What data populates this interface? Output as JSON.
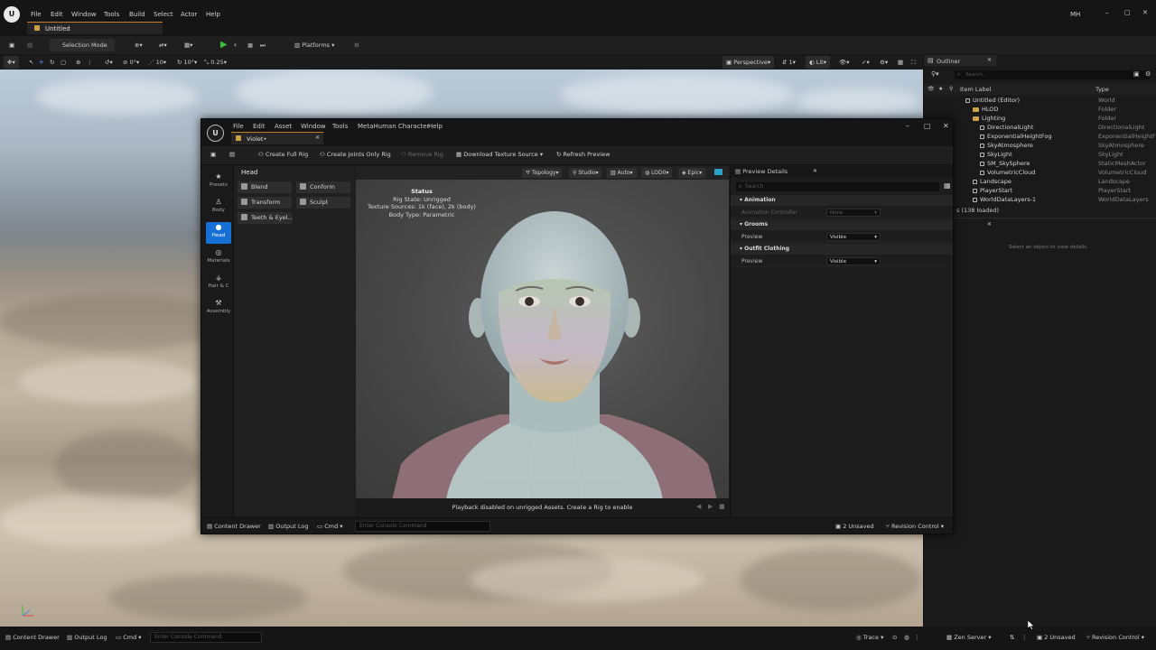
{
  "window": {
    "title": "Untitled",
    "user": "MH"
  },
  "main_menu": [
    "File",
    "Edit",
    "Window",
    "Tools",
    "Build",
    "Select",
    "Actor",
    "Help"
  ],
  "main_toolbar": {
    "selection_mode": "Selection Mode",
    "platforms": "Platforms"
  },
  "viewport_toolbar": {
    "angle_snap": "0°",
    "grid_snap": "10",
    "rotation_snap": "10°",
    "scale_snap": "0.25",
    "view_mode": "Perspective",
    "lighting": "Lit",
    "camera_speed": "1"
  },
  "outliner": {
    "tab": "Outliner",
    "search_placeholder": "Search...",
    "col_label": "Item Label",
    "col_type": "Type",
    "items": [
      {
        "label": "Untitled (Editor)",
        "type": "World"
      },
      {
        "label": "HLOD",
        "type": "Folder"
      },
      {
        "label": "Lighting",
        "type": "Folder"
      },
      {
        "label": "DirectionalLight",
        "type": "DirectionalLight"
      },
      {
        "label": "ExponentialHeightFog",
        "type": "ExponentialHeightF"
      },
      {
        "label": "SkyAtmosphere",
        "type": "SkyAtmosphere"
      },
      {
        "label": "SkyLight",
        "type": "SkyLight"
      },
      {
        "label": "SM_SkySphere",
        "type": "StaticMeshActor"
      },
      {
        "label": "VolumetricCloud",
        "type": "VolumetricCloud"
      },
      {
        "label": "Landscape",
        "type": "Landscape"
      },
      {
        "label": "PlayerStart",
        "type": "PlayerStart"
      },
      {
        "label": "WorldDataLayers-1",
        "type": "WorldDataLayers"
      }
    ],
    "count": "s (138 loaded)",
    "details_empty": "Select an object to view details."
  },
  "statusbar": {
    "content_drawer": "Content Drawer",
    "output_log": "Output Log",
    "cmd": "Cmd",
    "console_placeholder": "Enter Console Command",
    "trace": "Trace",
    "zen_server": "Zen Server",
    "unsaved": "2 Unsaved",
    "revision_control": "Revision Control"
  },
  "mh": {
    "menu": [
      "File",
      "Edit",
      "Asset",
      "Window",
      "Tools",
      "MetaHuman Character",
      "Help"
    ],
    "tab_title": "Violet•",
    "toolbar": {
      "create_full_rig": "Create Full Rig",
      "create_joints_rig": "Create Joints Only Rig",
      "remove_rig": "Remove Rig",
      "download_texture": "Download Texture Source",
      "refresh_preview": "Refresh Preview"
    },
    "sidebar": [
      "Presets",
      "Body",
      "Head",
      "Materials",
      "Hair & C",
      "Assembly"
    ],
    "tools_title": "Head",
    "tools": [
      "Blend",
      "Conform",
      "Transform",
      "Sculpt",
      "Teeth & Eyel..."
    ],
    "preview_toolbar": [
      "Topology",
      "Studio",
      "Auto",
      "LOD0",
      "Epic"
    ],
    "status": {
      "title": "Status",
      "rig_state": "Rig State: Unrigged",
      "texture_sources": "Texture Sources: 1k (face), 2k (body)",
      "body_type": "Body Type: Parametric"
    },
    "playback_msg": "Playback disabled on unrigged Assets. Create a Rig to enable",
    "details": {
      "tab_preview": "Preview",
      "tab_details": "Details",
      "search_placeholder": "Search",
      "sections": [
        {
          "title": "Animation",
          "row_label": "Animation Controller",
          "value": "None"
        },
        {
          "title": "Grooms",
          "row_label": "Preview",
          "value": "Visible"
        },
        {
          "title": "Outfit Clothing",
          "row_label": "Preview",
          "value": "Visible"
        }
      ]
    },
    "statusbar": {
      "content_drawer": "Content Drawer",
      "output_log": "Output Log",
      "cmd": "Cmd",
      "console_placeholder": "Enter Console Command",
      "unsaved": "2 Unsaved",
      "revision_control": "Revision Control"
    }
  }
}
